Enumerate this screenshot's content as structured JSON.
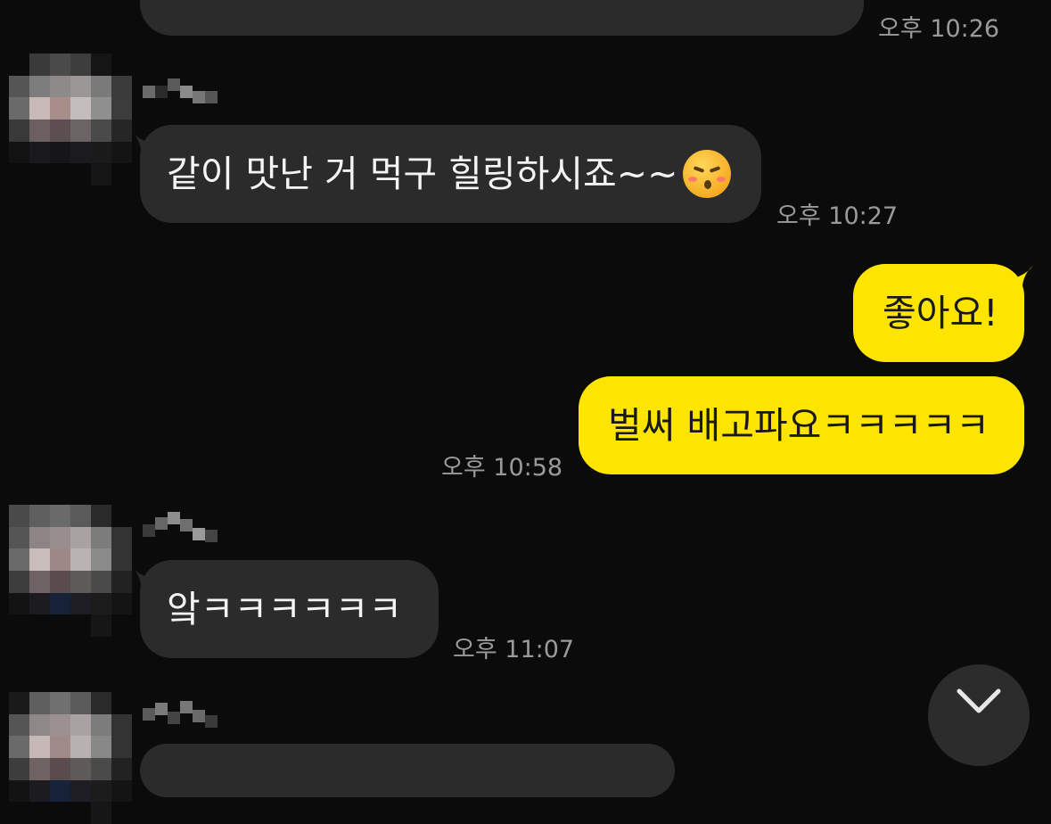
{
  "messages": [
    {
      "id": "m0",
      "direction": "incoming",
      "text": "",
      "time": "오후 10:26"
    },
    {
      "id": "m1",
      "direction": "incoming",
      "text": "같이 맛난 거 먹구 힐링하시죠~~",
      "emoji": "kissing-face-with-closed-eyes-icon",
      "time": "오후 10:27"
    },
    {
      "id": "m2",
      "direction": "outgoing",
      "text": "좋아요!"
    },
    {
      "id": "m3",
      "direction": "outgoing",
      "text": "벌써 배고파요ㅋㅋㅋㅋㅋ",
      "time": "오후 10:58"
    },
    {
      "id": "m4",
      "direction": "incoming",
      "text": "앜ㅋㅋㅋㅋㅋㅋ",
      "time": "오후 11:07"
    }
  ],
  "scroll_button": {
    "icon": "chevron-down-icon"
  },
  "colors": {
    "background": "#0b0b0b",
    "incoming_bubble": "#2b2b2b",
    "outgoing_bubble": "#fee500",
    "timestamp": "#9a9a9a"
  }
}
